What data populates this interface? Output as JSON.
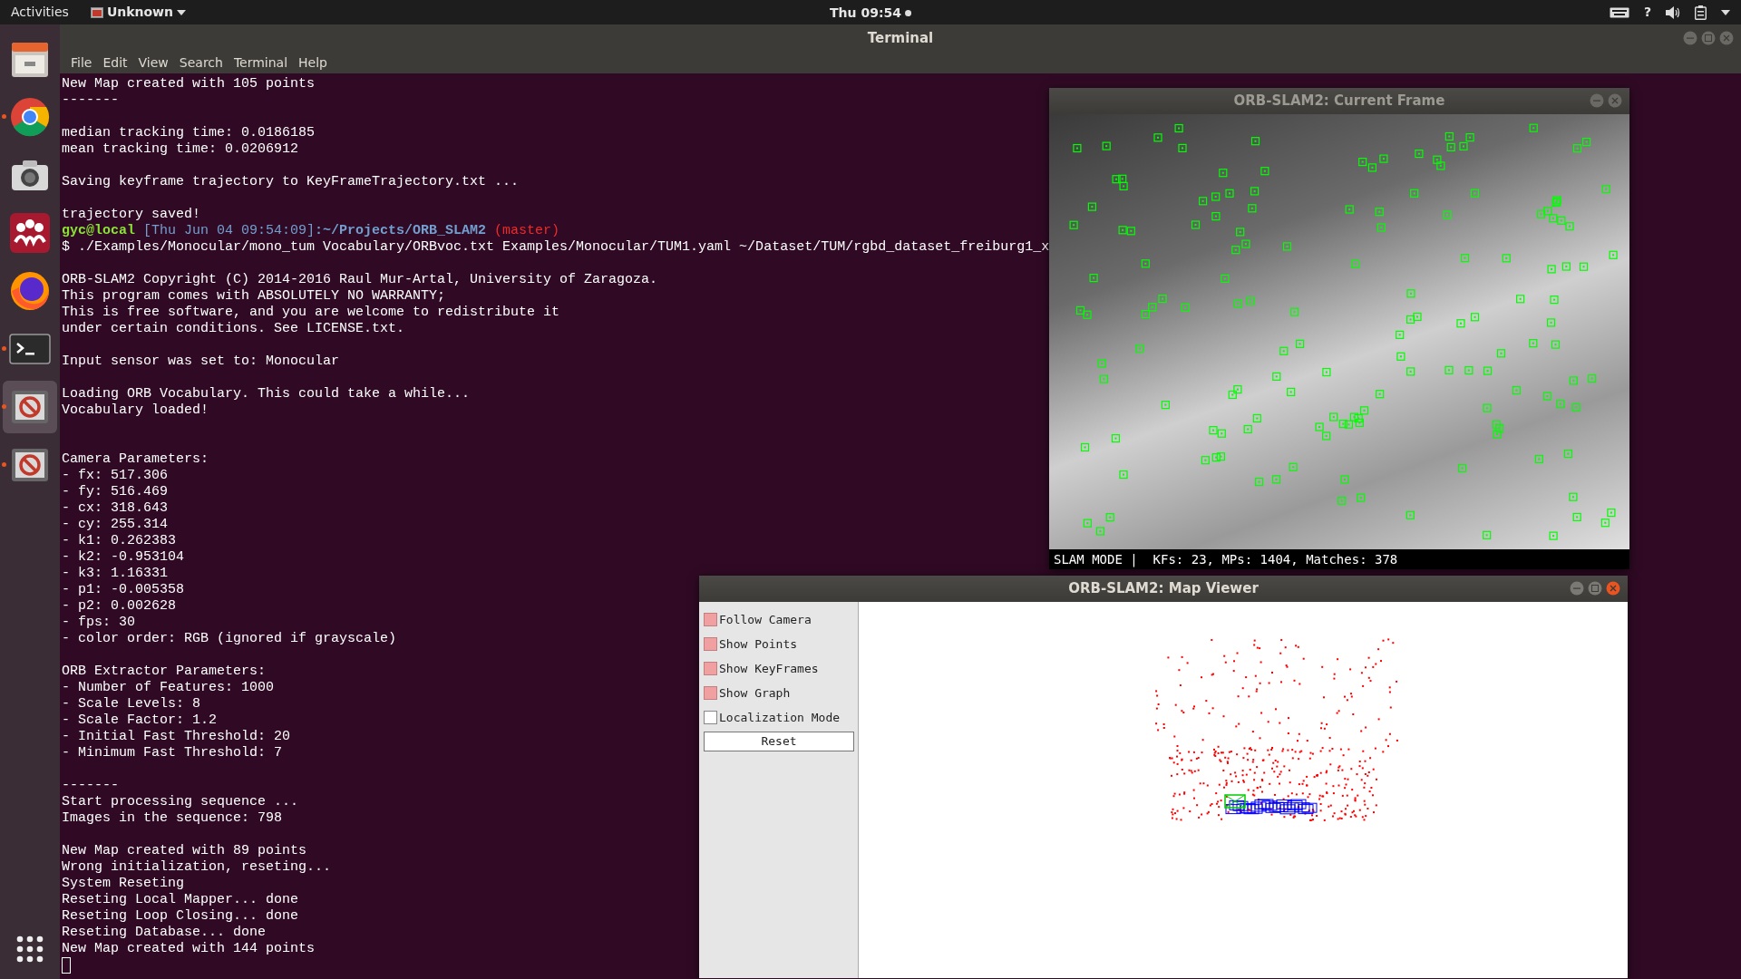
{
  "top_bar": {
    "activities": "Activities",
    "app_menu": "Unknown",
    "clock": "Thu 09:54",
    "help": "?"
  },
  "dock": [
    {
      "kind": "files",
      "running": false,
      "selected": false
    },
    {
      "kind": "browser",
      "running": true,
      "selected": false
    },
    {
      "kind": "camera",
      "running": false,
      "selected": false
    },
    {
      "kind": "reference",
      "running": false,
      "selected": false
    },
    {
      "kind": "firefox",
      "running": false,
      "selected": false
    },
    {
      "kind": "terminal",
      "running": true,
      "selected": false
    },
    {
      "kind": "blocked",
      "running": true,
      "selected": true
    },
    {
      "kind": "blocked",
      "running": true,
      "selected": false
    }
  ],
  "terminal": {
    "title": "Terminal",
    "menu": [
      "File",
      "Edit",
      "View",
      "Search",
      "Terminal",
      "Help"
    ],
    "lines": [
      {
        "kind": "text",
        "text": "New Map created with 105 points"
      },
      {
        "kind": "text",
        "text": "-------"
      },
      {
        "kind": "blank"
      },
      {
        "kind": "text",
        "text": "median tracking time: 0.0186185"
      },
      {
        "kind": "text",
        "text": "mean tracking time: 0.0206912"
      },
      {
        "kind": "blank"
      },
      {
        "kind": "text",
        "text": "Saving keyframe trajectory to KeyFrameTrajectory.txt ..."
      },
      {
        "kind": "blank"
      },
      {
        "kind": "text",
        "text": "trajectory saved!"
      },
      {
        "kind": "prompt",
        "segments": [
          {
            "kind": "user",
            "text": "gyc@local"
          },
          {
            "kind": "time",
            "text": "[Thu Jun 04 09:54:09]"
          },
          {
            "kind": "path",
            "text": ":~/Projects/ORB_SLAM2"
          },
          {
            "kind": "branch",
            "text": "(master)"
          }
        ]
      },
      {
        "kind": "text",
        "text": "$ ./Examples/Monocular/mono_tum Vocabulary/ORBvoc.txt Examples/Monocular/TUM1.yaml ~/Dataset/TUM/rgbd_dataset_freiburg1_x"
      },
      {
        "kind": "blank"
      },
      {
        "kind": "text",
        "text": "ORB-SLAM2 Copyright (C) 2014-2016 Raul Mur-Artal, University of Zaragoza."
      },
      {
        "kind": "text",
        "text": "This program comes with ABSOLUTELY NO WARRANTY;"
      },
      {
        "kind": "text",
        "text": "This is free software, and you are welcome to redistribute it"
      },
      {
        "kind": "text",
        "text": "under certain conditions. See LICENSE.txt."
      },
      {
        "kind": "blank"
      },
      {
        "kind": "text",
        "text": "Input sensor was set to: Monocular"
      },
      {
        "kind": "blank"
      },
      {
        "kind": "text",
        "text": "Loading ORB Vocabulary. This could take a while..."
      },
      {
        "kind": "text",
        "text": "Vocabulary loaded!"
      },
      {
        "kind": "blank"
      },
      {
        "kind": "blank"
      },
      {
        "kind": "text",
        "text": "Camera Parameters:"
      },
      {
        "kind": "text",
        "text": "- fx: 517.306"
      },
      {
        "kind": "text",
        "text": "- fy: 516.469"
      },
      {
        "kind": "text",
        "text": "- cx: 318.643"
      },
      {
        "kind": "text",
        "text": "- cy: 255.314"
      },
      {
        "kind": "text",
        "text": "- k1: 0.262383"
      },
      {
        "kind": "text",
        "text": "- k2: -0.953104"
      },
      {
        "kind": "text",
        "text": "- k3: 1.16331"
      },
      {
        "kind": "text",
        "text": "- p1: -0.005358"
      },
      {
        "kind": "text",
        "text": "- p2: 0.002628"
      },
      {
        "kind": "text",
        "text": "- fps: 30"
      },
      {
        "kind": "text",
        "text": "- color order: RGB (ignored if grayscale)"
      },
      {
        "kind": "blank"
      },
      {
        "kind": "text",
        "text": "ORB Extractor Parameters:"
      },
      {
        "kind": "text",
        "text": "- Number of Features: 1000"
      },
      {
        "kind": "text",
        "text": "- Scale Levels: 8"
      },
      {
        "kind": "text",
        "text": "- Scale Factor: 1.2"
      },
      {
        "kind": "text",
        "text": "- Initial Fast Threshold: 20"
      },
      {
        "kind": "text",
        "text": "- Minimum Fast Threshold: 7"
      },
      {
        "kind": "blank"
      },
      {
        "kind": "text",
        "text": "-------"
      },
      {
        "kind": "text",
        "text": "Start processing sequence ..."
      },
      {
        "kind": "text",
        "text": "Images in the sequence: 798"
      },
      {
        "kind": "blank"
      },
      {
        "kind": "text",
        "text": "New Map created with 89 points"
      },
      {
        "kind": "text",
        "text": "Wrong initialization, reseting..."
      },
      {
        "kind": "text",
        "text": "System Reseting"
      },
      {
        "kind": "text",
        "text": "Reseting Local Mapper... done"
      },
      {
        "kind": "text",
        "text": "Reseting Loop Closing... done"
      },
      {
        "kind": "text",
        "text": "Reseting Database... done"
      },
      {
        "kind": "text",
        "text": "New Map created with 144 points"
      },
      {
        "kind": "cursor"
      }
    ]
  },
  "current_frame": {
    "title": "ORB-SLAM2: Current Frame",
    "status": "SLAM MODE |  KFs: 23, MPs: 1404, Matches: 378"
  },
  "map_viewer": {
    "title": "ORB-SLAM2: Map Viewer",
    "options": [
      {
        "label": "Follow Camera",
        "checked": true
      },
      {
        "label": "Show Points",
        "checked": true
      },
      {
        "label": "Show KeyFrames",
        "checked": true
      },
      {
        "label": "Show Graph",
        "checked": true
      },
      {
        "label": "Localization Mode",
        "checked": false
      }
    ],
    "reset": "Reset"
  }
}
